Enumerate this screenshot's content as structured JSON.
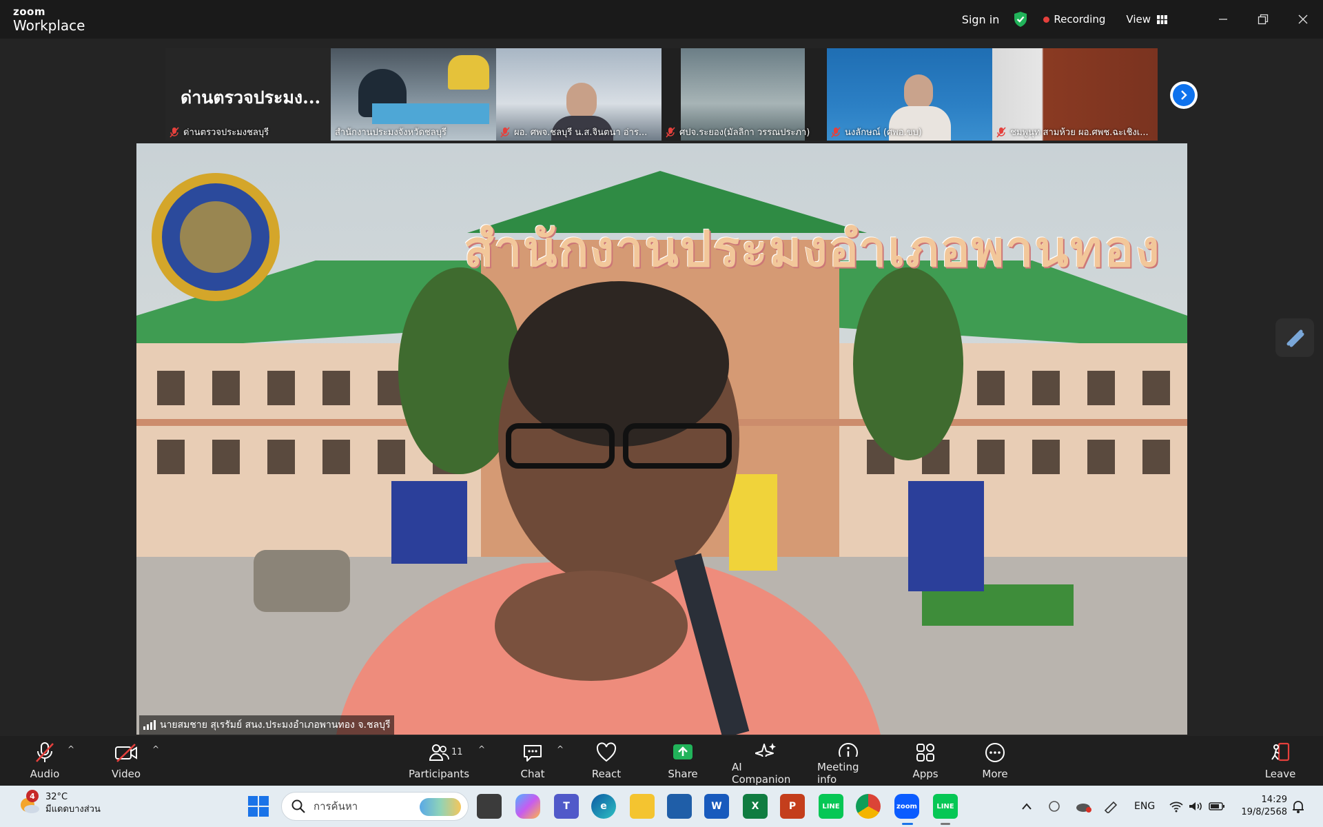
{
  "app": {
    "brand_small": "zoom",
    "brand_large": "Workplace"
  },
  "titlebar": {
    "sign_in": "Sign in",
    "recording": "Recording",
    "view": "View"
  },
  "thumbnails": [
    {
      "big_text": "ด่านตรวจประมง...",
      "name": "ด่านตรวจประมงชลบุรี",
      "bg": "#262626"
    },
    {
      "big_text": "",
      "name": "สำนักงานประมงจังหวัดชลบุรี",
      "bg": "#5f6b74"
    },
    {
      "big_text": "",
      "name": "ผอ. ศพจ.ชลบุรี น.ส.จินตนา  อ่าร...",
      "bg": "#7b8a98"
    },
    {
      "big_text": "",
      "name": "ศปจ.ระยอง(มัลลิกา วรรณประภา)",
      "bg": "#3c4a50"
    },
    {
      "big_text": "",
      "name": "นงลักษณ์ (ศพอ.ขบ)",
      "bg": "#2a6fae"
    },
    {
      "big_text": "",
      "name": "ชมพูนุท สามห้วย ผอ.ศพช.ฉะเชิงเ...",
      "bg": "#8b6a55"
    }
  ],
  "main_video": {
    "background_title": "สำนักงานประมงอำเภอพานทอง",
    "speaker_name": "นายสมชาย สุเรรัมย์ สนง.ประมงอำเภอพานทอง จ.ชลบุรี"
  },
  "toolbar": {
    "audio": "Audio",
    "video": "Video",
    "participants": "Participants",
    "participants_count": "11",
    "chat": "Chat",
    "react": "React",
    "share": "Share",
    "ai_companion": "AI Companion",
    "meeting_info": "Meeting info",
    "apps": "Apps",
    "more": "More",
    "leave": "Leave",
    "accent_green": "#21b35a",
    "danger_red": "#e5403c"
  },
  "taskbar": {
    "weather_badge": "4",
    "temperature": "32°C",
    "weather_desc": "มีแดดบางส่วน",
    "search_placeholder": "การค้นหา",
    "language": "ENG",
    "time": "14:29",
    "date": "19/8/2568"
  }
}
